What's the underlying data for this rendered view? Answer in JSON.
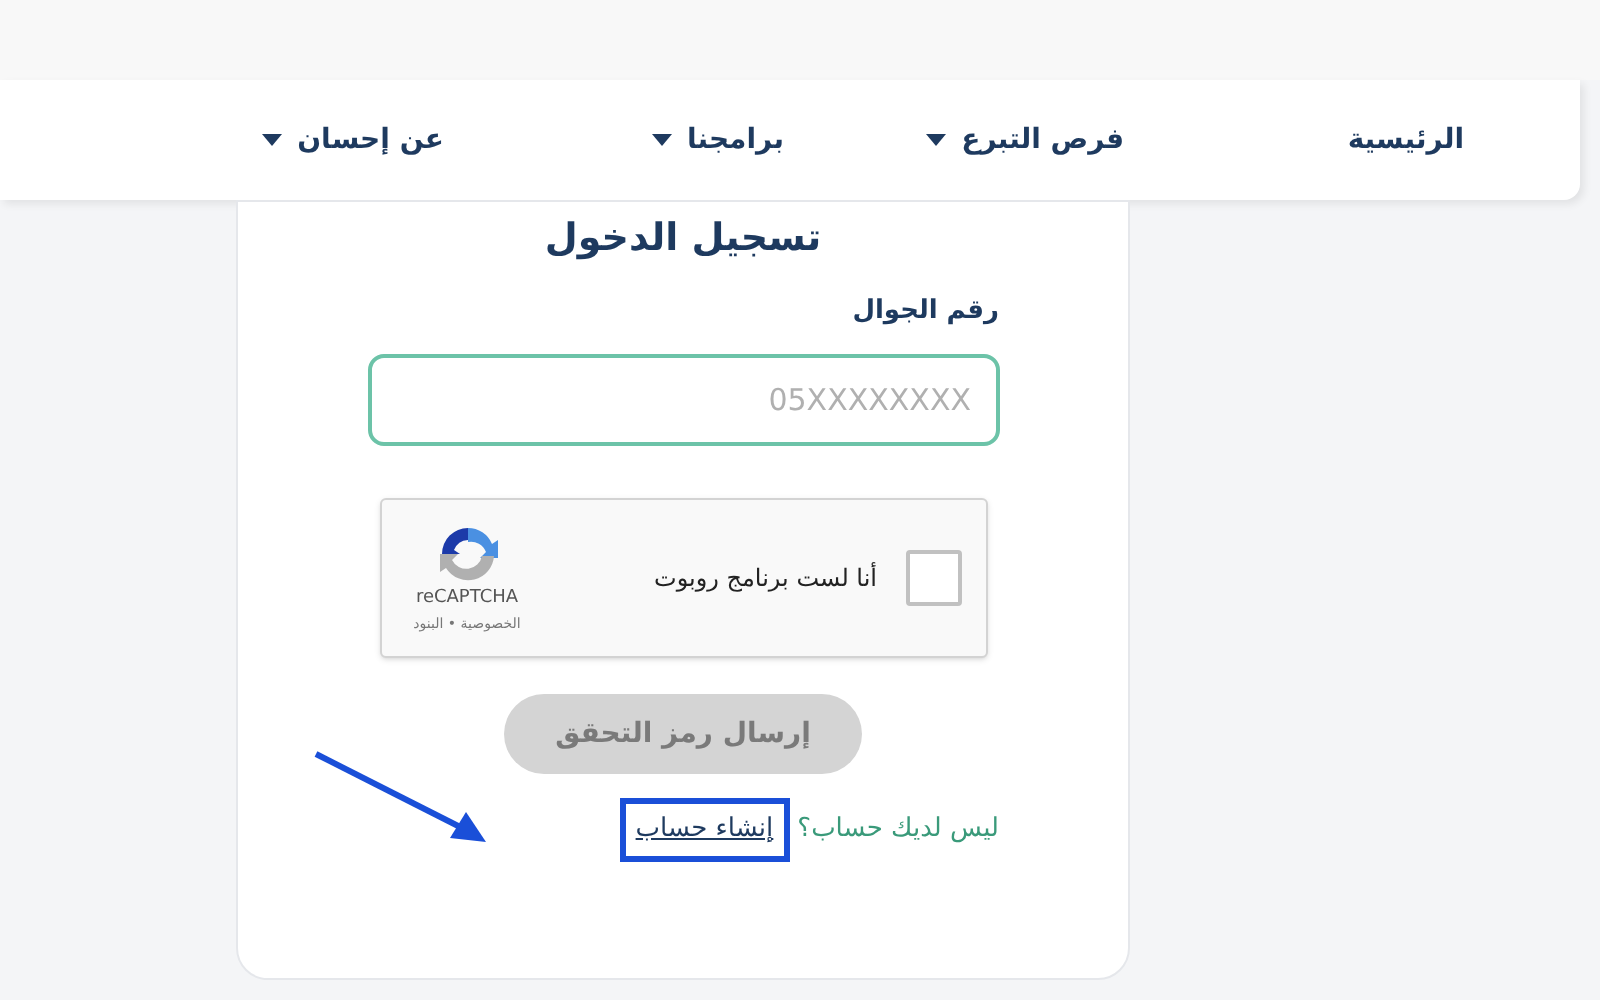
{
  "nav": {
    "items": [
      {
        "label": "الرئيسية",
        "has_dropdown": false
      },
      {
        "label": "فرص التبرع",
        "has_dropdown": true
      },
      {
        "label": "برامجنا",
        "has_dropdown": true
      },
      {
        "label": "عن إحسان",
        "has_dropdown": true
      }
    ]
  },
  "login": {
    "title": "تسجيل الدخول",
    "phone_label": "رقم الجوال",
    "phone_placeholder": "05XXXXXXXX",
    "captcha": {
      "label": "أنا لست برنامج روبوت",
      "checked": false,
      "brand": "reCAPTCHA",
      "links": "الخصوصية • البنود"
    },
    "submit": {
      "label": "إرسال رمز التحقق",
      "disabled": true
    },
    "signup_prompt": "ليس لديك حساب؟",
    "signup_link": "إنشاء حساب"
  }
}
